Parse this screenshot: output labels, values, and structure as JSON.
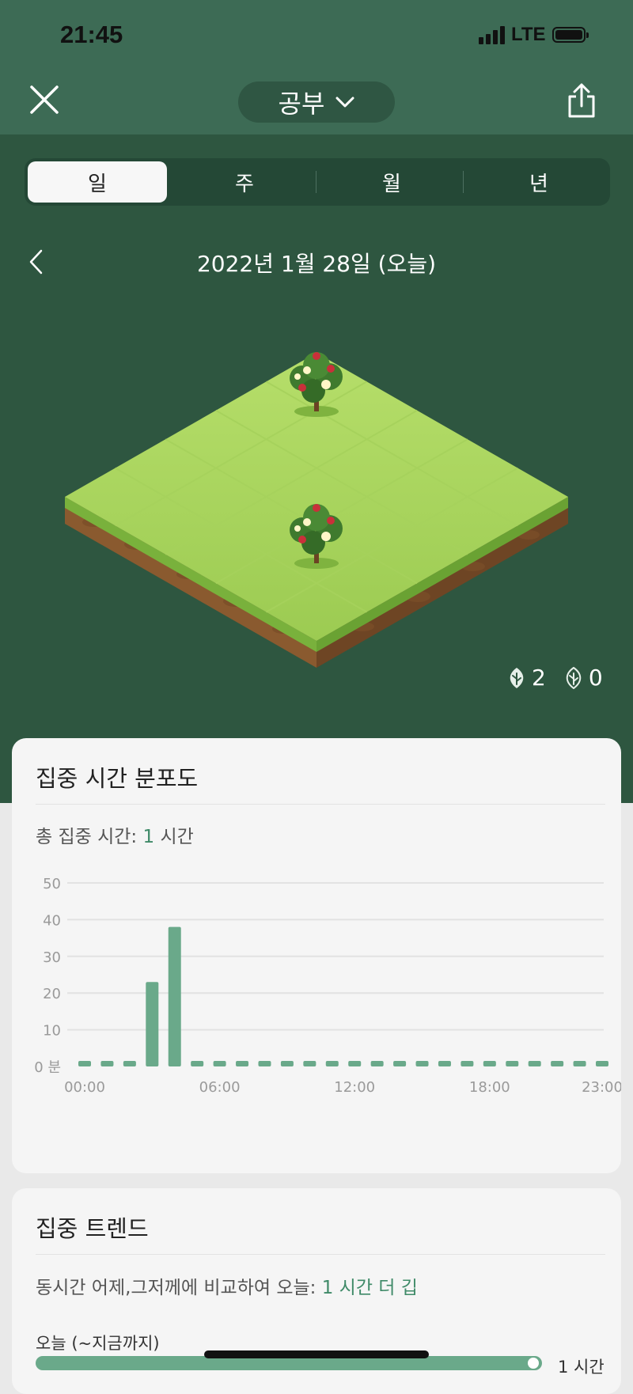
{
  "status_bar": {
    "time": "21:45",
    "network": "LTE"
  },
  "header": {
    "title": "공부"
  },
  "period_tabs": [
    "일",
    "주",
    "월",
    "년"
  ],
  "date_label": "2022년 1월 28일 (오늘)",
  "tree_counts": {
    "healthy": "2",
    "dead": "0"
  },
  "distribution": {
    "title": "집중 시간 분포도",
    "total_label": "총 집중 시간:",
    "total_value": "1",
    "total_unit": "시간"
  },
  "chart_data": {
    "type": "bar",
    "categories": [
      "00:00",
      "01:00",
      "02:00",
      "03:00",
      "04:00",
      "05:00",
      "06:00",
      "07:00",
      "08:00",
      "09:00",
      "10:00",
      "11:00",
      "12:00",
      "13:00",
      "14:00",
      "15:00",
      "16:00",
      "17:00",
      "18:00",
      "19:00",
      "20:00",
      "21:00",
      "22:00",
      "23:00"
    ],
    "values": [
      0,
      0,
      0,
      23,
      38,
      0,
      0,
      0,
      0,
      0,
      0,
      0,
      0,
      0,
      0,
      0,
      0,
      0,
      0,
      0,
      0,
      0,
      0,
      0
    ],
    "ylim": [
      0,
      50
    ],
    "yticks": [
      "0 분",
      "10",
      "20",
      "30",
      "40",
      "50"
    ],
    "xticks": [
      "00:00",
      "06:00",
      "12:00",
      "18:00",
      "23:00"
    ],
    "bar_color": "#6aa98a",
    "grid": true
  },
  "trend": {
    "title": "집중 트렌드",
    "compare_label": "동시간 어제,그저께에 비교하여 오늘:",
    "compare_value": "1 시간 더 깁",
    "today_label": "오늘 (~지금까지)",
    "today_value": "1 시간",
    "today_level": 1
  },
  "colors": {
    "header_bg": "#3d6b55",
    "content_bg": "#2e5640",
    "accent": "#3f8a68"
  },
  "icons": {
    "close": "close-icon",
    "chevron": "chevron-down-icon",
    "share": "share-icon",
    "back": "chevron-left-icon",
    "leaf": "leaf-icon",
    "dead_leaf": "withered-leaf-icon"
  }
}
